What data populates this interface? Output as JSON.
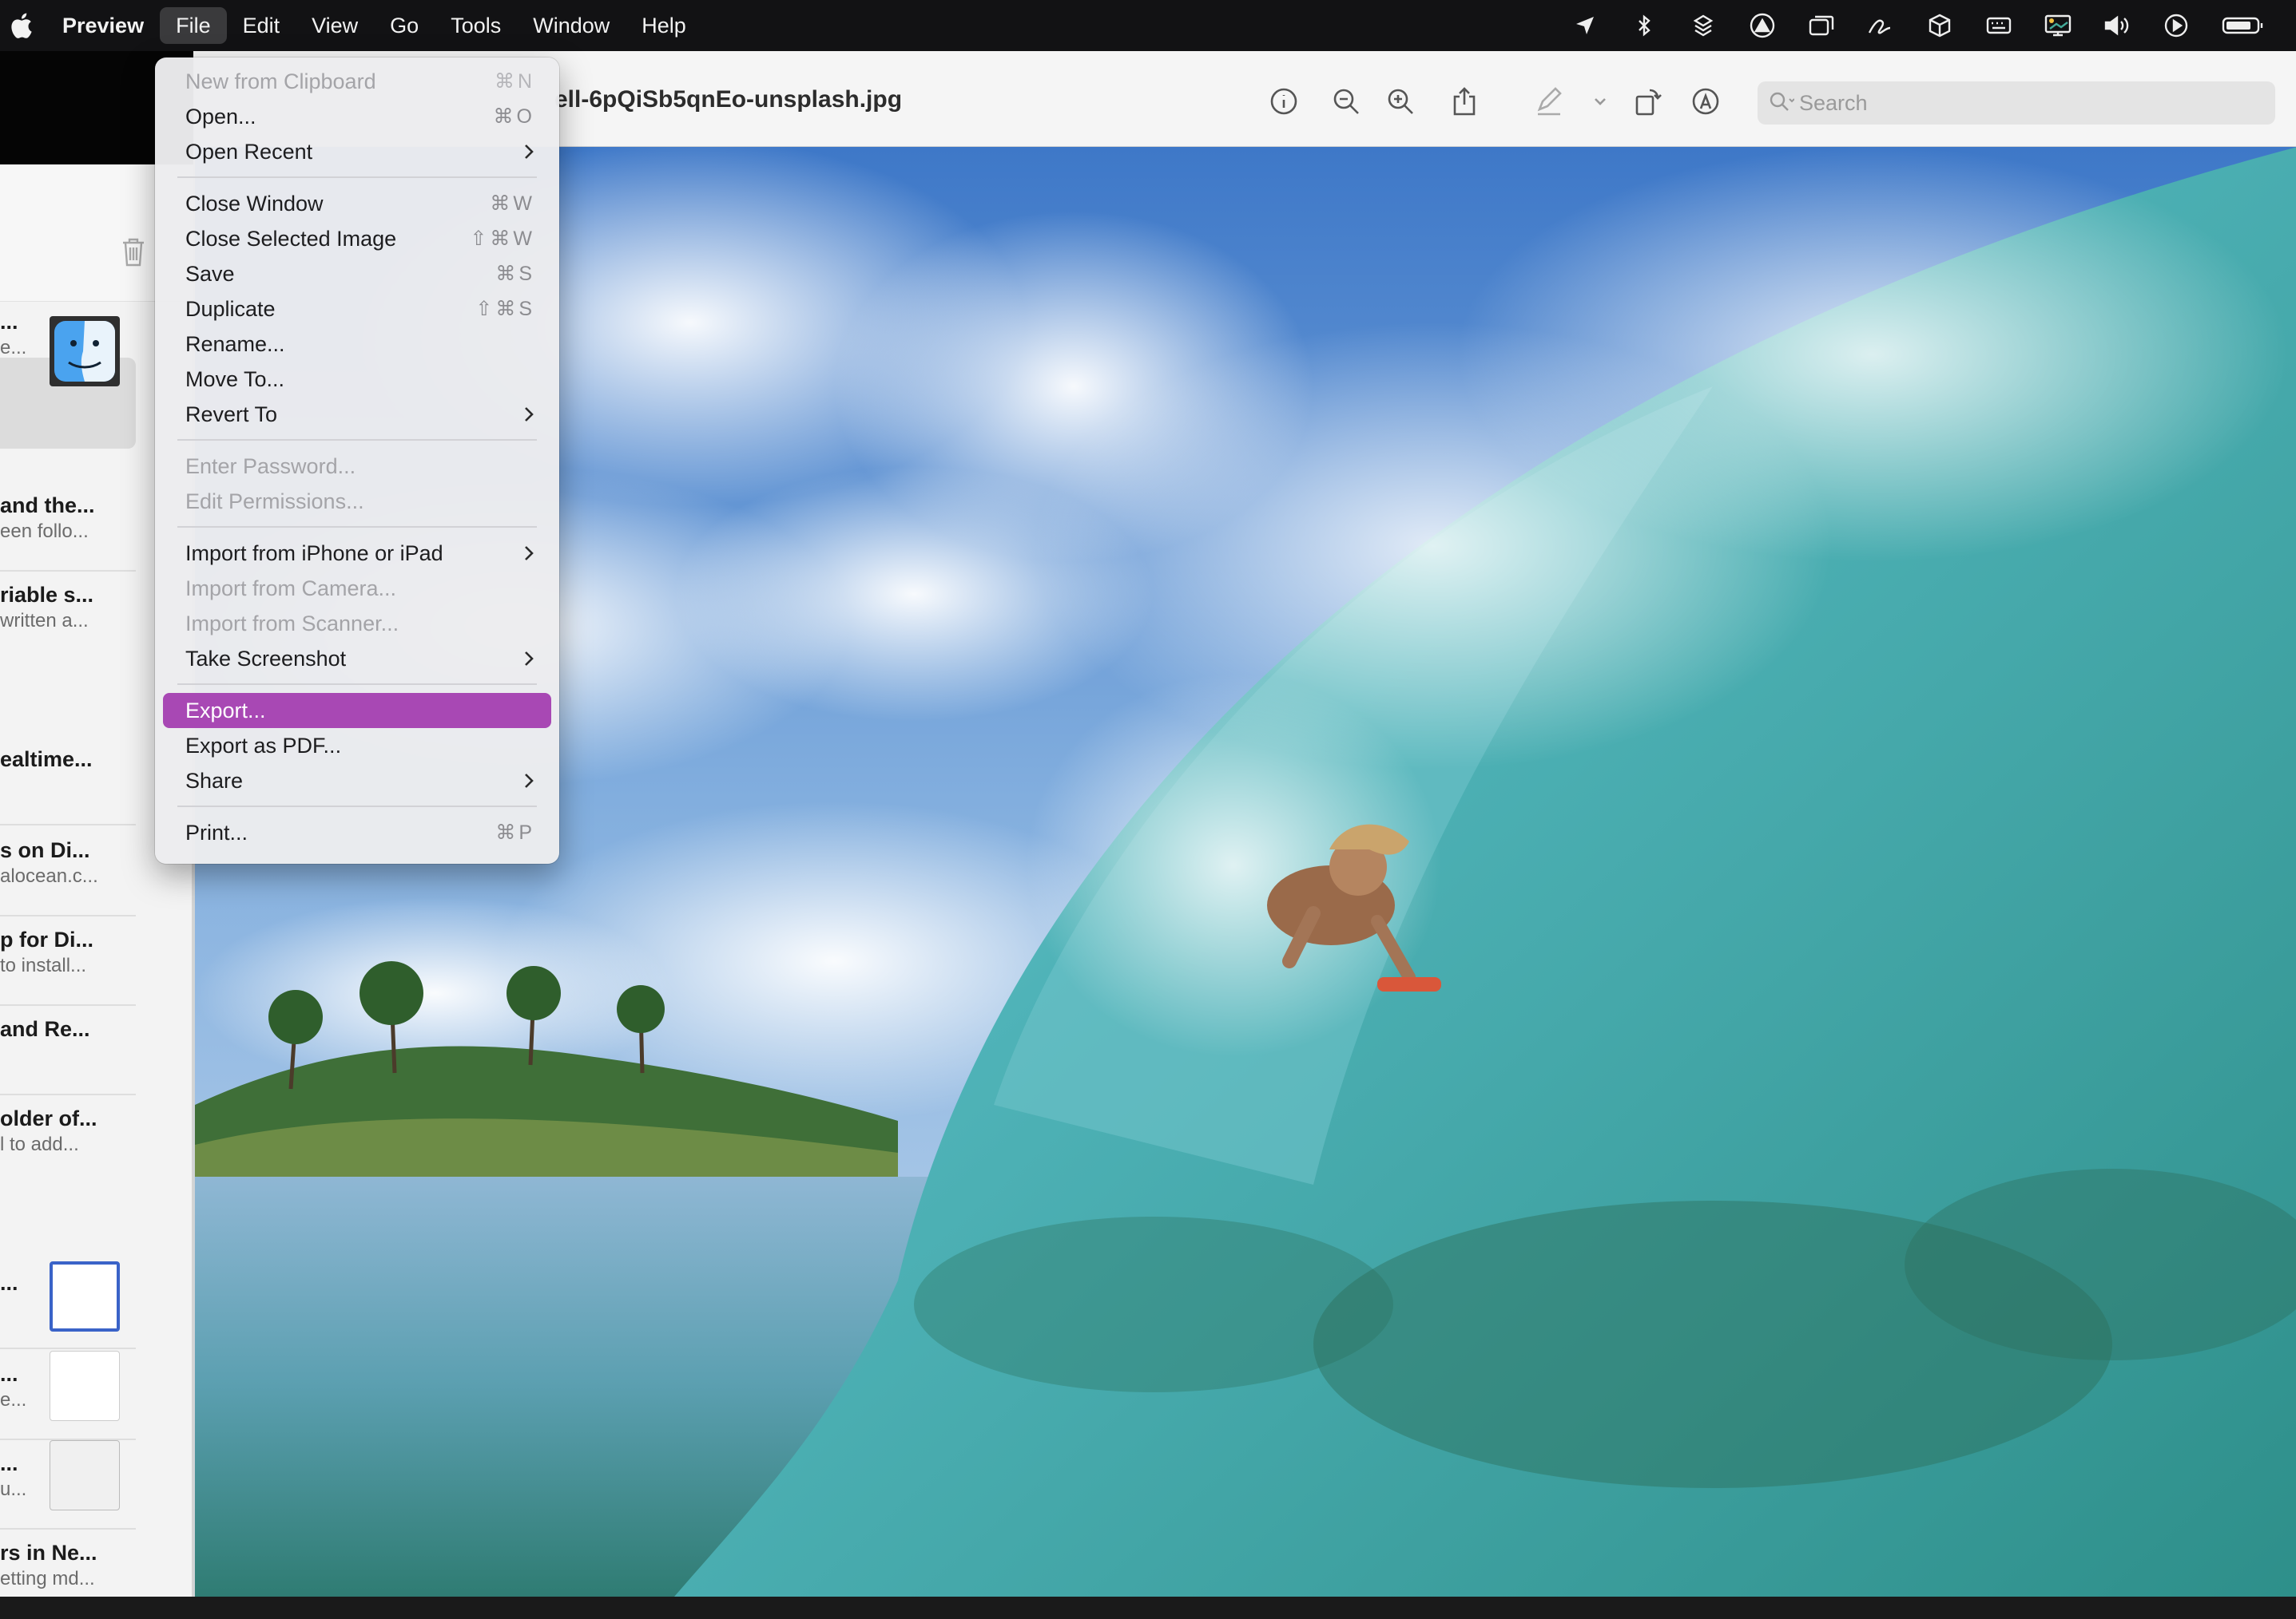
{
  "menubar": {
    "app_name": "Preview",
    "menus": [
      "File",
      "Edit",
      "View",
      "Go",
      "Tools",
      "Window",
      "Help"
    ],
    "active_menu": "File",
    "status_icons": [
      "location-icon",
      "bluetooth-icon",
      "dropbox-icon",
      "focus-icon",
      "window-icon",
      "signature-icon",
      "package-icon",
      "keyboard-icon",
      "display-icon",
      "volume-icon",
      "play-icon",
      "battery-icon"
    ]
  },
  "window": {
    "title": "ell-6pQiSb5qnEo-unsplash.jpg",
    "search_placeholder": "Search"
  },
  "file_menu": {
    "items": [
      {
        "label": "New from Clipboard",
        "shortcut": "⌘N",
        "disabled": true
      },
      {
        "label": "Open...",
        "shortcut": "⌘O"
      },
      {
        "label": "Open Recent",
        "submenu": true
      },
      {
        "separator": true
      },
      {
        "label": "Close Window",
        "shortcut": "⌘W"
      },
      {
        "label": "Close Selected Image",
        "shortcut": "⇧⌘W"
      },
      {
        "label": "Save",
        "shortcut": "⌘S"
      },
      {
        "label": "Duplicate",
        "shortcut": "⇧⌘S"
      },
      {
        "label": "Rename..."
      },
      {
        "label": "Move To..."
      },
      {
        "label": "Revert To",
        "submenu": true
      },
      {
        "separator": true
      },
      {
        "label": "Enter Password...",
        "disabled": true
      },
      {
        "label": "Edit Permissions...",
        "disabled": true
      },
      {
        "separator": true
      },
      {
        "label": "Import from iPhone or iPad",
        "submenu": true
      },
      {
        "label": "Import from Camera...",
        "disabled": true
      },
      {
        "label": "Import from Scanner...",
        "disabled": true
      },
      {
        "label": "Take Screenshot",
        "submenu": true
      },
      {
        "separator": true
      },
      {
        "label": "Export...",
        "highlighted": true
      },
      {
        "label": "Export as PDF..."
      },
      {
        "label": "Share",
        "submenu": true
      },
      {
        "separator": true
      },
      {
        "label": "Print...",
        "shortcut": "⌘P"
      }
    ]
  },
  "sidebar_notes": [
    {
      "title": "...",
      "subtitle": "e..."
    },
    {
      "title": "and the...",
      "subtitle": "een follo..."
    },
    {
      "title": "riable s...",
      "subtitle": "written a..."
    },
    {
      "title": "ealtime...",
      "subtitle": ""
    },
    {
      "title": "s on Di...",
      "subtitle": "alocean.c..."
    },
    {
      "title": "p for Di...",
      "subtitle": "to install..."
    },
    {
      "title": "and Re...",
      "subtitle": ""
    },
    {
      "title": "older of...",
      "subtitle": "l to add..."
    },
    {
      "title": "...",
      "subtitle": ""
    },
    {
      "title": "...",
      "subtitle": "e..."
    },
    {
      "title": "...",
      "subtitle": "u..."
    },
    {
      "title": "rs in Ne...",
      "subtitle": "etting md..."
    }
  ],
  "colors": {
    "menu_highlight": "#a848b4",
    "menubar_bg": "#121214"
  }
}
